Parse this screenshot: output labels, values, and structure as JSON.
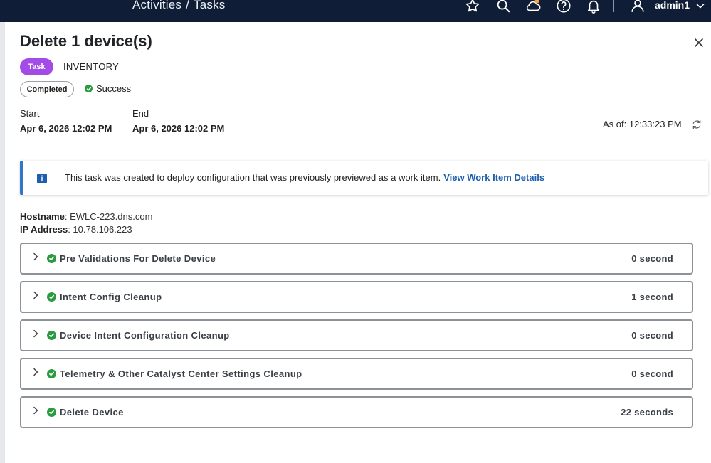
{
  "header": {
    "breadcrumb": [
      "Activities",
      "Tasks"
    ],
    "breadcrumb_separator": "/",
    "icons": [
      "star-icon",
      "search-icon",
      "cloud-icon",
      "help-icon",
      "bell-icon",
      "user-icon",
      "chevron-down-icon"
    ],
    "user_name": "admin1"
  },
  "task": {
    "title": "Delete 1 device(s)",
    "type_badge": "Task",
    "category": "INVENTORY",
    "status_badge": "Completed",
    "result": "Success",
    "start_label": "Start",
    "start_value": "Apr 6, 2026 12:02 PM",
    "end_label": "End",
    "end_value": "Apr 6, 2026 12:02 PM",
    "as_of": "As of: 12:33:23 PM"
  },
  "banner": {
    "message": "This task was created to deploy configuration that was previously previewed as a work item.",
    "link_label": "View Work Item Details"
  },
  "device": {
    "hostname_label": "Hostname",
    "hostname_value": ": EWLC-223.dns.com",
    "ip_label": "IP Address",
    "ip_value": ": 10.78.106.223"
  },
  "steps": [
    {
      "name": "Pre Validations For Delete Device",
      "duration": "0 second"
    },
    {
      "name": "Intent Config Cleanup",
      "duration": "1 second"
    },
    {
      "name": "Device Intent Configuration Cleanup",
      "duration": "0 second"
    },
    {
      "name": "Telemetry & Other Catalyst Center Settings Cleanup",
      "duration": "0 second"
    },
    {
      "name": "Delete Device",
      "duration": "22 seconds"
    }
  ],
  "colors": {
    "topbar": "#0f1d36",
    "task_badge": "#a24be6",
    "success": "#2a9b3f",
    "link": "#1d5fae",
    "banner_accent": "#2f77c8"
  }
}
